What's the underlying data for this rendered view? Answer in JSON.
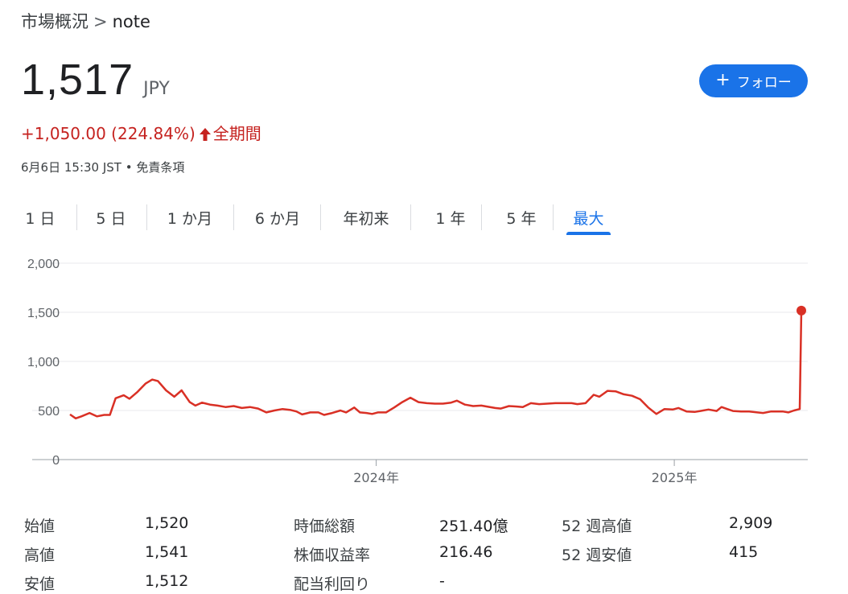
{
  "breadcrumb": {
    "parent": "市場概況",
    "separator": ">",
    "current": "note"
  },
  "quote": {
    "price": "1,517",
    "currency": "JPY",
    "change": "+1,050.00 (224.84%)",
    "period": "全期間",
    "timestamp": "6月6日 15:30 JST",
    "disclaimer": "• 免責条項"
  },
  "follow_button": {
    "label": "フォロー",
    "icon": "plus-icon"
  },
  "tabs": [
    {
      "label": "1 日"
    },
    {
      "label": "5 日"
    },
    {
      "label": "1 か月"
    },
    {
      "label": "6 か月"
    },
    {
      "label": "年初来"
    },
    {
      "label": "1 年"
    },
    {
      "label": "5 年"
    },
    {
      "label": "最大",
      "active": true
    }
  ],
  "colors": {
    "accent": "#1a73e8",
    "negative_line": "#d93025",
    "change_text": "#c5221f"
  },
  "chart_data": {
    "type": "line",
    "ylim": [
      0,
      2000
    ],
    "yticks": [
      {
        "value": 0,
        "label": "0"
      },
      {
        "value": 500,
        "label": "500"
      },
      {
        "value": 1000,
        "label": "1,000"
      },
      {
        "value": 1500,
        "label": "1,500"
      },
      {
        "value": 2000,
        "label": "2,000"
      }
    ],
    "xlim": [
      "2022-12-21",
      "2025-06-06"
    ],
    "xticks": [
      {
        "value": "2024-01-01",
        "label": "2024年"
      },
      {
        "value": "2025-01-01",
        "label": "2025年"
      }
    ],
    "grid": true,
    "series": [
      {
        "points": [
          [
            "2022-12-21",
            460
          ],
          [
            "2022-12-28",
            420
          ],
          [
            "2023-01-04",
            440
          ],
          [
            "2023-01-14",
            475
          ],
          [
            "2023-01-23",
            440
          ],
          [
            "2023-02-01",
            455
          ],
          [
            "2023-02-08",
            455
          ],
          [
            "2023-02-15",
            625
          ],
          [
            "2023-02-25",
            655
          ],
          [
            "2023-03-04",
            620
          ],
          [
            "2023-03-14",
            690
          ],
          [
            "2023-03-24",
            775
          ],
          [
            "2023-04-01",
            815
          ],
          [
            "2023-04-08",
            800
          ],
          [
            "2023-04-18",
            705
          ],
          [
            "2023-04-28",
            640
          ],
          [
            "2023-05-07",
            705
          ],
          [
            "2023-05-17",
            585
          ],
          [
            "2023-05-24",
            550
          ],
          [
            "2023-06-01",
            580
          ],
          [
            "2023-06-11",
            560
          ],
          [
            "2023-06-20",
            550
          ],
          [
            "2023-06-30",
            535
          ],
          [
            "2023-07-10",
            545
          ],
          [
            "2023-07-20",
            525
          ],
          [
            "2023-07-30",
            535
          ],
          [
            "2023-08-09",
            520
          ],
          [
            "2023-08-19",
            480
          ],
          [
            "2023-08-29",
            500
          ],
          [
            "2023-09-08",
            515
          ],
          [
            "2023-09-18",
            505
          ],
          [
            "2023-09-25",
            490
          ],
          [
            "2023-10-02",
            460
          ],
          [
            "2023-10-12",
            480
          ],
          [
            "2023-10-22",
            480
          ],
          [
            "2023-10-29",
            455
          ],
          [
            "2023-11-08",
            475
          ],
          [
            "2023-11-18",
            500
          ],
          [
            "2023-11-25",
            480
          ],
          [
            "2023-12-05",
            530
          ],
          [
            "2023-12-12",
            480
          ],
          [
            "2023-12-20",
            475
          ],
          [
            "2023-12-27",
            465
          ],
          [
            "2024-01-03",
            480
          ],
          [
            "2024-01-13",
            480
          ],
          [
            "2024-01-23",
            530
          ],
          [
            "2024-02-02",
            585
          ],
          [
            "2024-02-12",
            630
          ],
          [
            "2024-02-22",
            585
          ],
          [
            "2024-03-03",
            575
          ],
          [
            "2024-03-13",
            570
          ],
          [
            "2024-03-23",
            570
          ],
          [
            "2024-04-02",
            580
          ],
          [
            "2024-04-09",
            600
          ],
          [
            "2024-04-19",
            560
          ],
          [
            "2024-04-29",
            545
          ],
          [
            "2024-05-09",
            550
          ],
          [
            "2024-05-16",
            540
          ],
          [
            "2024-05-26",
            525
          ],
          [
            "2024-06-02",
            520
          ],
          [
            "2024-06-12",
            545
          ],
          [
            "2024-06-22",
            540
          ],
          [
            "2024-06-29",
            535
          ],
          [
            "2024-07-09",
            575
          ],
          [
            "2024-07-19",
            565
          ],
          [
            "2024-07-29",
            570
          ],
          [
            "2024-08-08",
            575
          ],
          [
            "2024-08-18",
            575
          ],
          [
            "2024-08-28",
            575
          ],
          [
            "2024-09-04",
            565
          ],
          [
            "2024-09-14",
            575
          ],
          [
            "2024-09-24",
            660
          ],
          [
            "2024-10-01",
            640
          ],
          [
            "2024-10-11",
            700
          ],
          [
            "2024-10-21",
            695
          ],
          [
            "2024-10-31",
            665
          ],
          [
            "2024-11-10",
            650
          ],
          [
            "2024-11-20",
            615
          ],
          [
            "2024-11-30",
            530
          ],
          [
            "2024-12-10",
            465
          ],
          [
            "2024-12-20",
            515
          ],
          [
            "2024-12-30",
            510
          ],
          [
            "2025-01-06",
            525
          ],
          [
            "2025-01-16",
            490
          ],
          [
            "2025-01-26",
            485
          ],
          [
            "2025-02-02",
            495
          ],
          [
            "2025-02-12",
            510
          ],
          [
            "2025-02-22",
            495
          ],
          [
            "2025-02-28",
            535
          ],
          [
            "2025-03-07",
            515
          ],
          [
            "2025-03-14",
            495
          ],
          [
            "2025-03-24",
            490
          ],
          [
            "2025-04-03",
            490
          ],
          [
            "2025-04-13",
            480
          ],
          [
            "2025-04-20",
            475
          ],
          [
            "2025-04-30",
            490
          ],
          [
            "2025-05-07",
            490
          ],
          [
            "2025-05-14",
            490
          ],
          [
            "2025-05-21",
            480
          ],
          [
            "2025-05-28",
            500
          ],
          [
            "2025-06-04",
            515
          ],
          [
            "2025-06-06",
            1517
          ]
        ]
      }
    ]
  },
  "stats": {
    "rows": [
      [
        {
          "label": "始値",
          "value": "1,520"
        },
        {
          "label": "時価総額",
          "value": "251.40億"
        },
        {
          "label": "52 週高値",
          "value": "2,909"
        }
      ],
      [
        {
          "label": "高値",
          "value": "1,541"
        },
        {
          "label": "株価収益率",
          "value": "216.46"
        },
        {
          "label": "52 週安値",
          "value": "415"
        }
      ],
      [
        {
          "label": "安値",
          "value": "1,512"
        },
        {
          "label": "配当利回り",
          "value": "-"
        }
      ]
    ]
  }
}
